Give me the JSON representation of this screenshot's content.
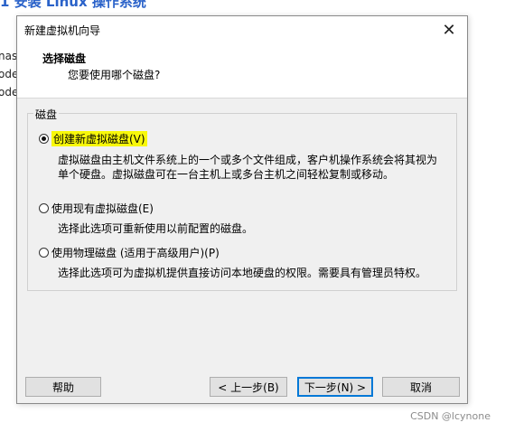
{
  "background": {
    "top_text": "1 安装 Linux 操作系统",
    "fragments": [
      "nast",
      "ode",
      "ode"
    ]
  },
  "dialog": {
    "title": "新建虚拟机向导",
    "header": {
      "title": "选择磁盘",
      "subtitle": "您要使用哪个磁盘?"
    },
    "group_label": "磁盘",
    "options": [
      {
        "label": "创建新虚拟磁盘(V)",
        "checked": true,
        "desc_lines": [
          "虚拟磁盘由主机文件系统上的一个或多个文件组成，客户机操作系统会将其视为",
          "单个硬盘。虚拟磁盘可在一台主机上或多台主机之间轻松复制或移动。"
        ]
      },
      {
        "label": "使用现有虚拟磁盘(E)",
        "checked": false,
        "desc_lines": [
          "选择此选项可重新使用以前配置的磁盘。"
        ]
      },
      {
        "label": "使用物理磁盘 (适用于高级用户)(P)",
        "checked": false,
        "desc_lines": [
          "选择此选项可为虚拟机提供直接访问本地硬盘的权限。需要具有管理员特权。"
        ]
      }
    ],
    "buttons": {
      "help": "帮助",
      "back": "< 上一步(B)",
      "next": "下一步(N) >",
      "cancel": "取消"
    }
  },
  "watermark": "CSDN @lcynone",
  "colors": {
    "highlight": "#f8f80a",
    "dialog_bg": "#f0f0f0",
    "primary_border": "#0078d7"
  }
}
